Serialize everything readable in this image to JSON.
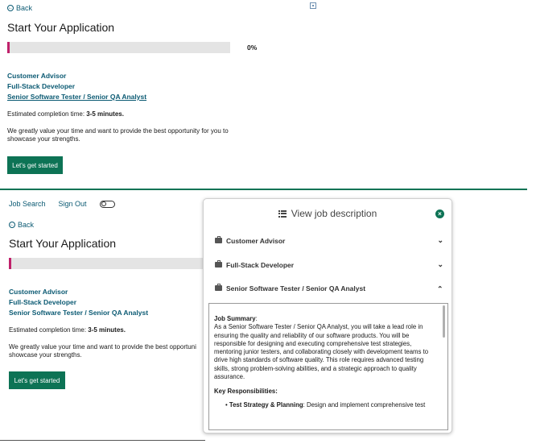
{
  "top": {
    "back_label": "Back",
    "title": "Start Your Application",
    "progress_label": "0%",
    "jobs": [
      "Customer Advisor",
      "Full-Stack Developer",
      "Senior Software Tester / Senior QA Analyst"
    ],
    "estimated_prefix": "Estimated completion time: ",
    "estimated_value": "3-5 minutes.",
    "value_text": "We greatly value your time and want to provide the best opportunity for you to showcase your strengths.",
    "start_button": "Let's get started"
  },
  "nav": {
    "job_search": "Job Search",
    "sign_out": "Sign Out"
  },
  "bottom": {
    "back_label": "Back",
    "title": "Start Your Application",
    "jobs": [
      "Customer Advisor",
      "Full-Stack Developer",
      "Senior Software Tester / Senior QA Analyst"
    ],
    "estimated_prefix": "Estimated completion time: ",
    "estimated_value": "3-5 minutes.",
    "value_text_line1": "We greatly value your time and want to provide the best opportuni",
    "value_text_line2": "showcase your strengths.",
    "start_button": "Let's get started"
  },
  "panel": {
    "title": "View job description",
    "items": [
      "Customer Advisor",
      "Full-Stack Developer",
      "Senior Software Tester / Senior QA Analyst"
    ],
    "job_summary_heading": "Job Summary",
    "job_summary_text": "As a Senior Software Tester / Senior QA Analyst, you will take a lead role in ensuring the quality and reliability of our software products. You will be responsible for designing and executing comprehensive test strategies, mentoring junior testers, and collaborating closely with development teams to drive high standards of software quality. This role requires advanced testing skills, strong problem-solving abilities, and a strategic approach to quality assurance.",
    "key_resp_heading": "Key Responsibilities:",
    "resp_item_title": "Test Strategy & Planning",
    "resp_item_text": ": Design and implement comprehensive test"
  },
  "colors": {
    "brand_green": "#0d7355",
    "link_teal": "#0b5a73",
    "progress_marker": "#c0216b"
  }
}
